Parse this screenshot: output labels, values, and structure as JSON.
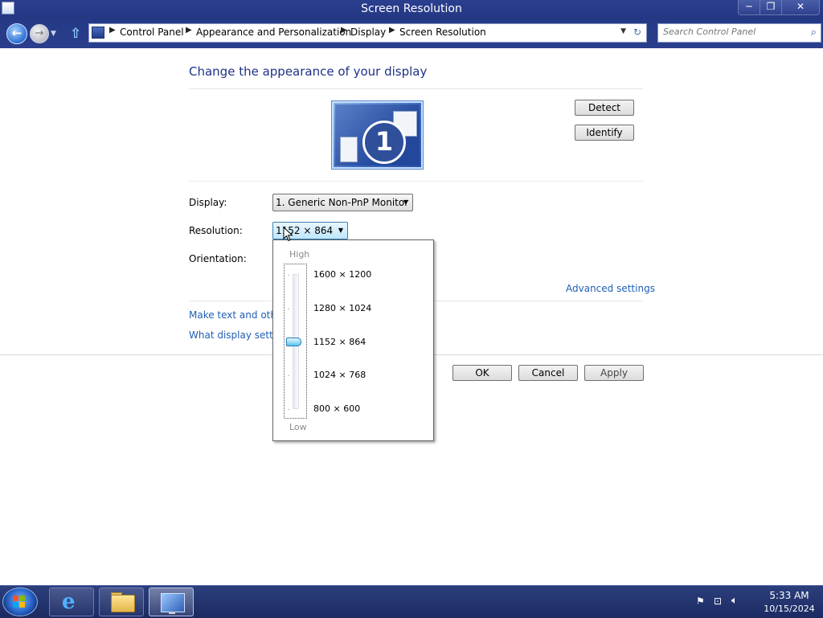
{
  "window": {
    "title": "Screen Resolution",
    "controls": {
      "minimize": "─",
      "maximize": "❐",
      "close": "✕"
    }
  },
  "nav": {
    "breadcrumbs": [
      "Control Panel",
      "Appearance and Personalization",
      "Display",
      "Screen Resolution"
    ],
    "search_placeholder": "Search Control Panel",
    "icons": [
      "back-icon",
      "forward-icon",
      "up-icon",
      "refresh-icon",
      "search-icon"
    ]
  },
  "main": {
    "heading": "Change the appearance of your display",
    "monitor_number": "1",
    "detect_label": "Detect",
    "identify_label": "Identify",
    "display_label": "Display:",
    "display_value": "1. Generic Non-PnP Monitor",
    "resolution_label": "Resolution:",
    "resolution_value": "1152 × 864",
    "orientation_label": "Orientation:",
    "advanced_settings": "Advanced settings",
    "link_make_text": "Make text and other",
    "link_what_settings": "What display setting",
    "ok_label": "OK",
    "cancel_label": "Cancel",
    "apply_label": "Apply"
  },
  "resolution_popup": {
    "high_label": "High",
    "low_label": "Low",
    "options": [
      "1600 × 1200",
      "1280 × 1024",
      "1152 × 864",
      "1024 × 768",
      "800 × 600"
    ],
    "selected": "1152 × 864"
  },
  "taskbar": {
    "apps": [
      "Internet Explorer",
      "File Explorer",
      "Screen Resolution"
    ],
    "time": "5:33 AM",
    "date": "10/15/2024"
  },
  "colors": {
    "titlebar": "#2b3f8f",
    "heading": "#1e3287",
    "link": "#1f5fb5",
    "taskbar": "#1b2a62"
  }
}
